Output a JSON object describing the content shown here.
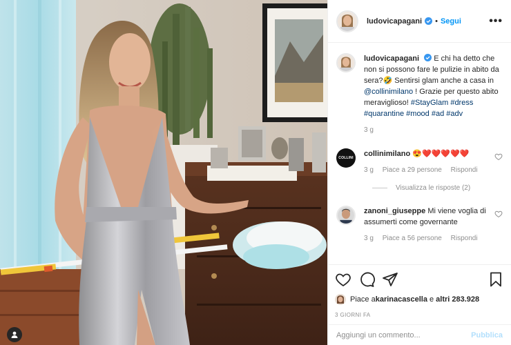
{
  "post": {
    "username": "ludovicapagani",
    "follow_label": "Segui",
    "dot": "•",
    "more_label": "•••"
  },
  "caption": {
    "username": "ludovicapagani",
    "text_1": "E chi ha detto che non si possono fare le pulizie in abito da sera?",
    "emoji": "🤣",
    "text_2": " Sentirsi glam anche a casa in ",
    "mention": "@collinimilano",
    "text_3": " ! Grazie per questo abito meraviglioso! ",
    "hashtags": "#StayGlam #dress #quarantine #mood #ad #adv",
    "time": "3 g"
  },
  "comments": [
    {
      "username": "collinimilano",
      "avatar_text": "COLLINI",
      "text": "😍❤️❤️❤️❤️❤️",
      "time": "3 g",
      "likes": "Piace a 29 persone",
      "reply": "Rispondi",
      "view_replies": "Visualizza le risposte (2)"
    },
    {
      "username": "zanoni_giuseppe",
      "text": "Mi viene voglia di assumerti come governante",
      "time": "3 g",
      "likes": "Piace a 56 persone",
      "reply": "Rispondi"
    }
  ],
  "likes_line": {
    "prefix": "Piace a ",
    "user": "karinacascella",
    "middle": " e ",
    "others": "altri 283.928"
  },
  "date": "3 GIORNI FA",
  "add_comment": {
    "placeholder": "Aggiungi un commento...",
    "publish": "Pubblica"
  },
  "icons": {
    "like": "heart-icon",
    "comment": "comment-icon",
    "share": "share-icon",
    "save": "bookmark-icon",
    "user_tag": "user-tag-icon",
    "verified": "verified-badge-icon"
  },
  "colors": {
    "accent": "#0095f6",
    "publish_disabled": "#b2dffc",
    "muted": "#8e8e8e",
    "text": "#262626"
  }
}
